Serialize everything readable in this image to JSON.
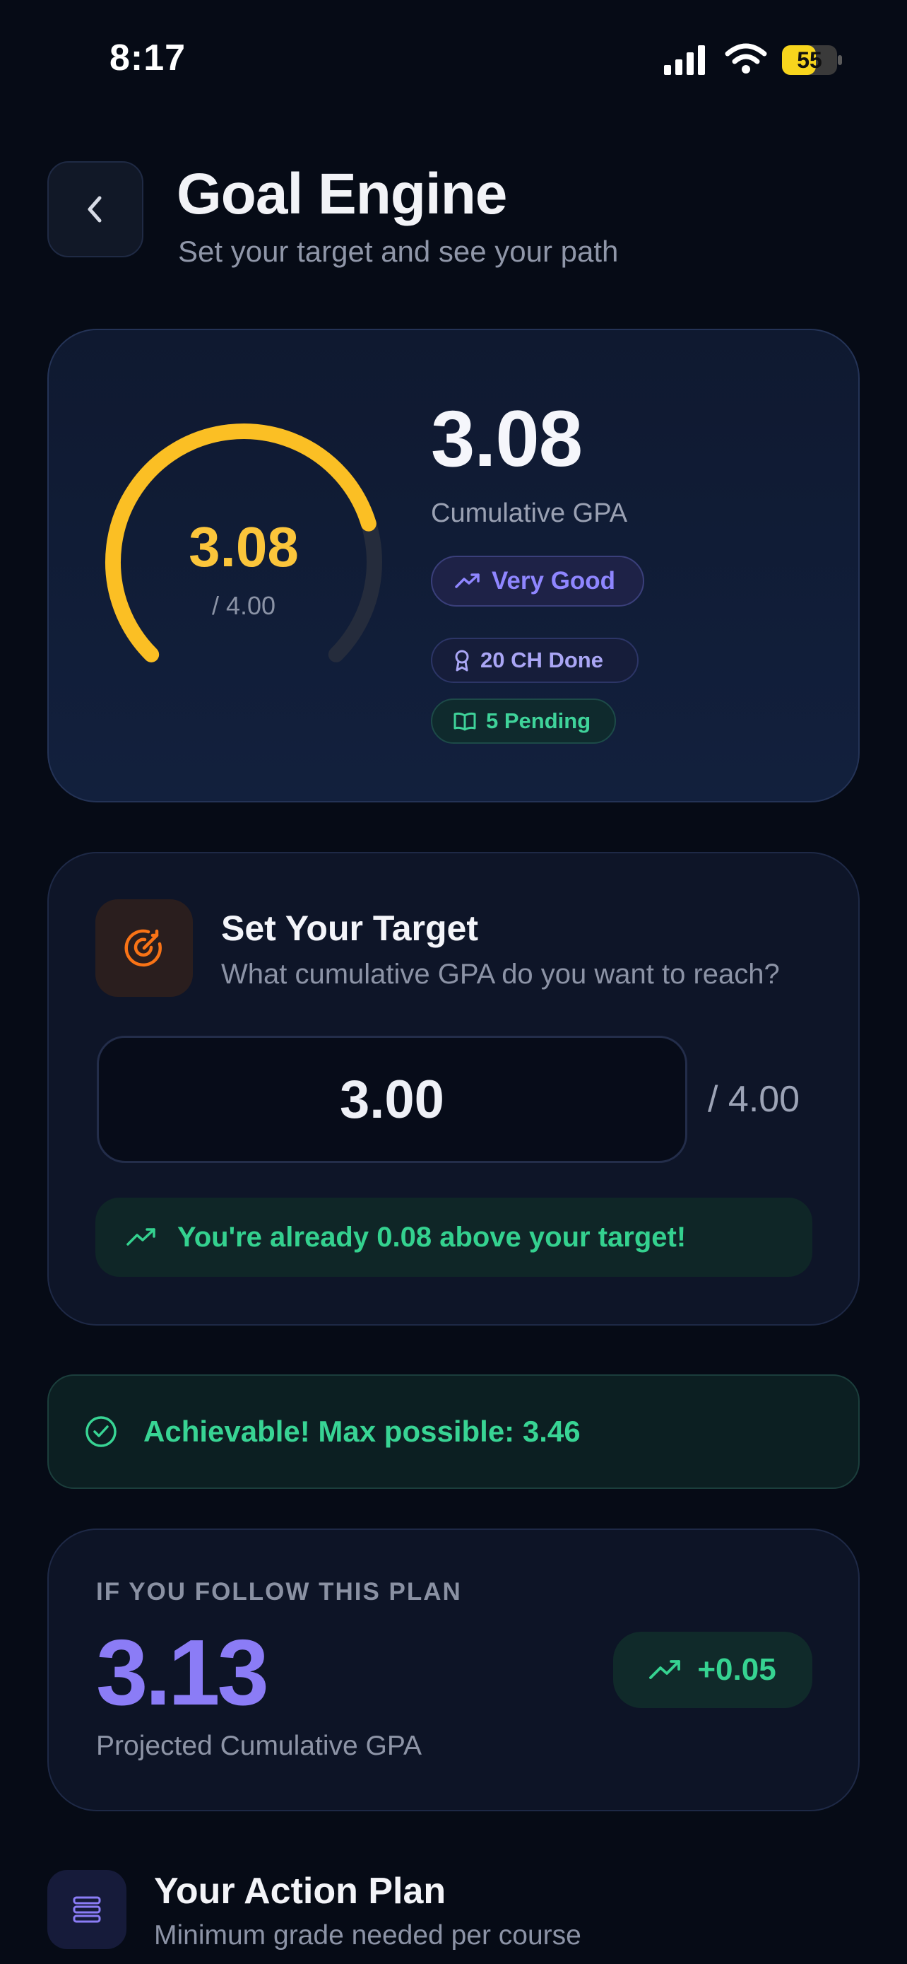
{
  "status_bar": {
    "time": "8:17",
    "battery": "55",
    "battery_color": "#f7d51d"
  },
  "header": {
    "title": "Goal Engine",
    "subtitle": "Set your target and see your path",
    "back_icon": "chevron-left-icon"
  },
  "gpa_card": {
    "gauge_value": "3.08",
    "gauge_max": "/ 4.00",
    "gauge_fill_fraction": 0.77,
    "gauge_color": "#fbbf24",
    "gpa": "3.08",
    "gpa_label": "Cumulative GPA",
    "badges": {
      "standing": "Very Good",
      "done": "20 CH Done",
      "pending": "5 Pending"
    }
  },
  "target_card": {
    "title": "Set Your Target",
    "subtitle": "What cumulative GPA do you want to reach?",
    "target_value": "3.00",
    "target_max": "/ 4.00",
    "note": "You're already 0.08 above your target!"
  },
  "achievable": {
    "text": "Achievable! Max possible: 3.46"
  },
  "plan_card": {
    "caption": "IF YOU FOLLOW THIS PLAN",
    "projected": "3.13",
    "label": "Projected Cumulative GPA",
    "delta": "+0.05"
  },
  "action_plan": {
    "title": "Your Action Plan",
    "subtitle": "Minimum grade needed per course"
  },
  "colors": {
    "background": "#060b16",
    "accent_purple": "#8b7cf6",
    "accent_green": "#34d399",
    "accent_orange": "#f97316"
  }
}
